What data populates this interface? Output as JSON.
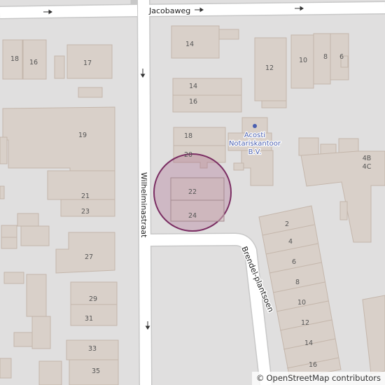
{
  "streets": {
    "jacobaweg": "Jacobaweg",
    "wilhelminastraat": "Wilhelminastraat",
    "brendel_plantsoen": "Brendel-plantsoen"
  },
  "poi": {
    "line1": "Acosti",
    "line2": "Notariskantoor",
    "line3": "B.V.",
    "color": "#4a5fb0"
  },
  "house_numbers": {
    "n18a": "18",
    "n16a": "16",
    "n17": "17",
    "n19": "19",
    "n21": "21",
    "n23": "23",
    "n27": "27",
    "n29": "29",
    "n31": "31",
    "n33": "33",
    "n35": "35",
    "n14a": "14",
    "n14b": "14",
    "n16b": "16",
    "n18b": "18",
    "n20": "20",
    "n22": "22",
    "n24": "24",
    "n12": "12",
    "n10a": "10",
    "n8a": "8",
    "n6a": "6",
    "n4b": "4B",
    "n4c": "4C",
    "n2": "2",
    "n4": "4",
    "n6b": "6",
    "n8b": "8",
    "n10b": "10",
    "n12b": "12",
    "n14c": "14",
    "n16c": "16"
  },
  "highlight": {
    "fill": "#a2527e",
    "stroke": "#7b2e63"
  },
  "colors": {
    "background": "#e0dfdf",
    "building": "#d9d0c9",
    "building_outline": "#c4b6ab",
    "road": "#ffffff",
    "road_casing": "#c8c8c8"
  },
  "attribution": {
    "copyright": "©",
    "link": "OpenStreetMap contributors"
  }
}
